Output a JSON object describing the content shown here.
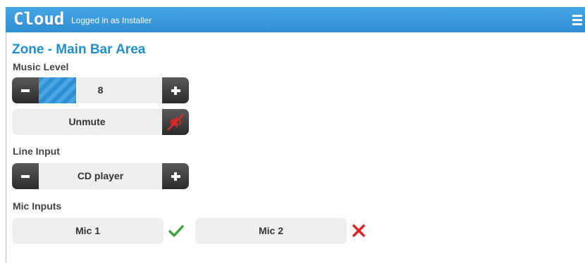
{
  "header": {
    "logo": "Cloud",
    "logged_in": "Logged in as Installer",
    "menu_icon": "hamburger-menu-icon",
    "bar_color": "#3a9bdc"
  },
  "zone": {
    "title": "Zone - Main Bar Area"
  },
  "music": {
    "label": "Music Level",
    "level": 8,
    "level_text": "8",
    "level_fraction": 0.3,
    "mute_label": "Unmute",
    "mute_icon": "speaker-muted-icon",
    "muted": true
  },
  "line_input": {
    "label": "Line Input",
    "value": "CD player"
  },
  "mic": {
    "label": "Mic Inputs",
    "items": [
      {
        "name": "Mic 1",
        "status": "enabled",
        "icon": "checkmark-icon",
        "color": "#3aa53a"
      },
      {
        "name": "Mic 2",
        "status": "disabled",
        "icon": "cross-icon",
        "color": "#dd2222"
      }
    ]
  }
}
